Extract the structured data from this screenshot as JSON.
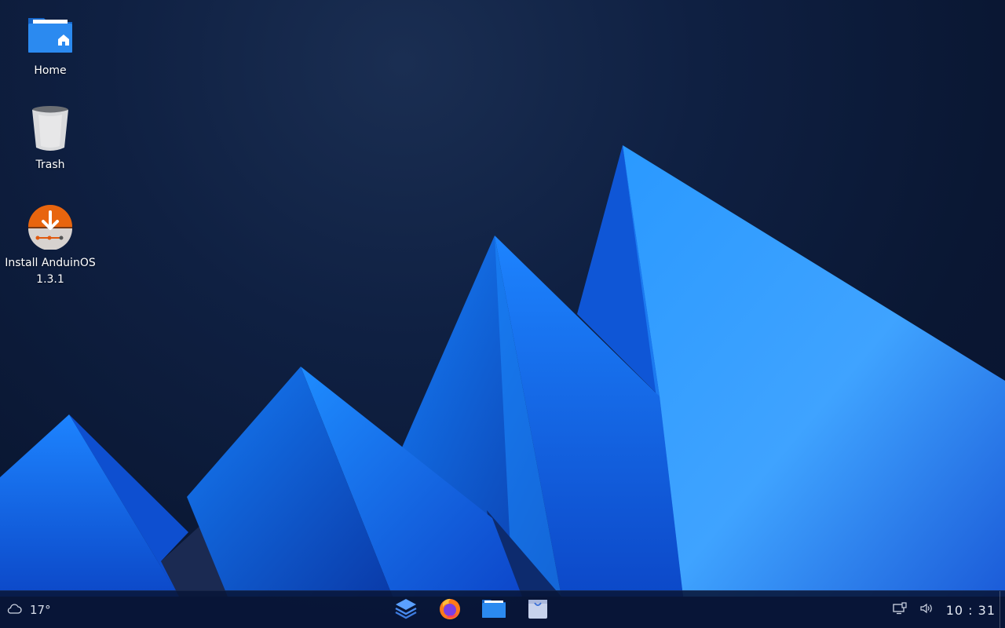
{
  "desktop": {
    "icons": [
      {
        "label": "Home",
        "icon": "home-folder-icon"
      },
      {
        "label": "Trash",
        "icon": "trash-icon"
      },
      {
        "label": "Install AnduinOS\n1.3.1",
        "icon": "installer-icon"
      }
    ]
  },
  "taskbar": {
    "weather": {
      "icon": "cloud-icon",
      "temperature": "17°"
    },
    "dock": [
      {
        "name": "task-view",
        "icon": "layers-icon"
      },
      {
        "name": "firefox",
        "icon": "firefox-icon"
      },
      {
        "name": "files",
        "icon": "folder-icon"
      },
      {
        "name": "software",
        "icon": "store-bag-icon"
      }
    ],
    "tray": {
      "network_icon": "network-icon",
      "volume_icon": "volume-icon",
      "clock": "10 : 31"
    }
  },
  "colors": {
    "accent": "#1e88ff",
    "taskbar": "#081638",
    "installer_orange": "#e8650e"
  }
}
